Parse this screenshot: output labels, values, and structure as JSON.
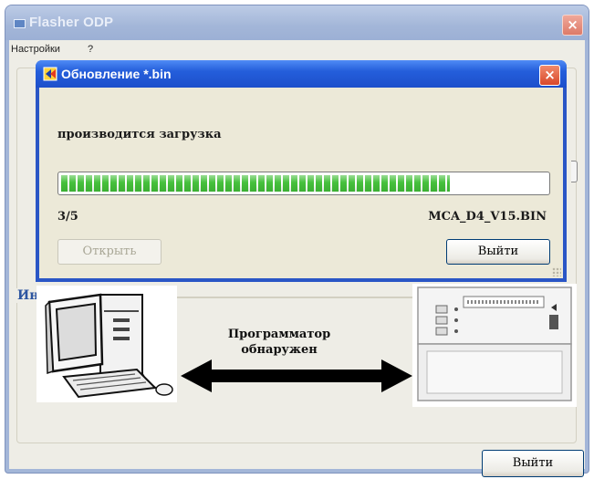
{
  "main_window": {
    "title": "Flasher ODP",
    "menu": [
      "Настройки",
      "?"
    ],
    "info_group_label": "Информация",
    "programmer_status": [
      "Программатор",
      "обнаружен"
    ],
    "exit_button": "Выйти"
  },
  "dialog": {
    "title": "Обновление *.bin",
    "status": "производится загрузка",
    "progress": 0.8,
    "count": "3/5",
    "file_name": "MCA_D4_V15.BIN",
    "open_button": "Открыть",
    "exit_button": "Выйти"
  },
  "colors": {
    "dialog_title": "#245edb",
    "progress_green": "#46c03c",
    "info_label": "#2d55a0",
    "close_red": "#d9482a"
  },
  "icons": {
    "main_close": "×",
    "dialog_close": "×"
  }
}
